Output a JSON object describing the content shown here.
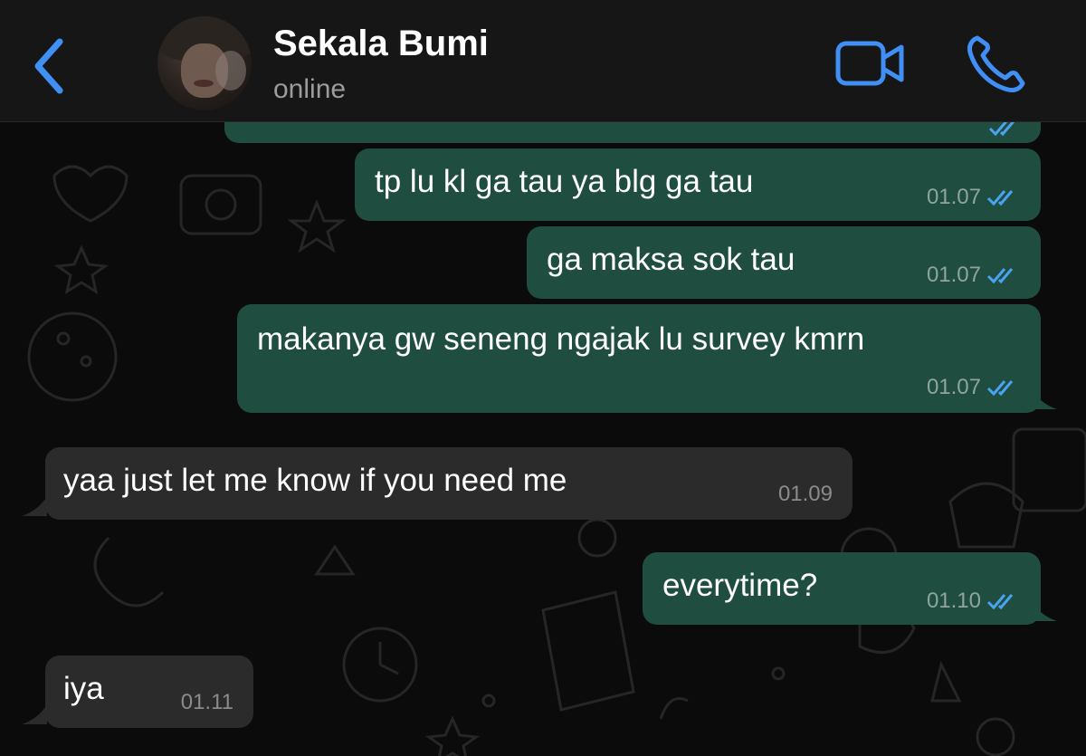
{
  "header": {
    "contact_name": "Sekala Bumi",
    "status": "online"
  },
  "messages": [
    {
      "direction": "out",
      "text": "",
      "time": "",
      "read": true
    },
    {
      "direction": "out",
      "text": "tp lu kl ga tau ya blg ga tau",
      "time": "01.07",
      "read": true
    },
    {
      "direction": "out",
      "text": "ga maksa sok tau",
      "time": "01.07",
      "read": true
    },
    {
      "direction": "out",
      "text": "makanya gw seneng ngajak lu survey kmrn",
      "time": "01.07",
      "read": true
    },
    {
      "direction": "in",
      "text": "yaa just let me know if you need me",
      "time": "01.09"
    },
    {
      "direction": "out",
      "text": "everytime?",
      "time": "01.10",
      "read": true
    },
    {
      "direction": "in",
      "text": "iya",
      "time": "01.11"
    }
  ],
  "colors": {
    "accent": "#3f8ff5",
    "outgoing_bubble": "#1f4d40",
    "incoming_bubble": "#2b2b2b",
    "read_tick": "#4aa3f0"
  }
}
